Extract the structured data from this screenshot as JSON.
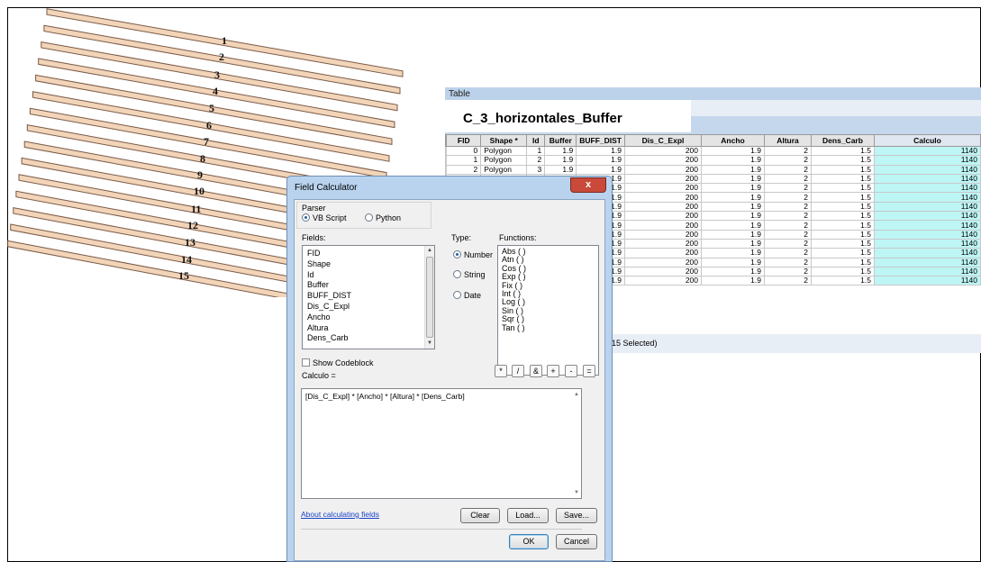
{
  "map": {
    "strip_labels": [
      "1",
      "2",
      "3",
      "4",
      "5",
      "6",
      "7",
      "8",
      "9",
      "10",
      "11",
      "12",
      "13",
      "14",
      "15"
    ]
  },
  "table_window": {
    "title": "Table",
    "layer_name": "C_3_horizontales_Buffer",
    "columns": [
      "FID",
      "Shape *",
      "Id",
      "Buffer",
      "BUFF_DIST",
      "Dis_C_Expl",
      "Ancho",
      "Altura",
      "Dens_Carb",
      "Calculo"
    ],
    "rows": [
      [
        "0",
        "Polygon",
        "1",
        "1.9",
        "1.9",
        "200",
        "1.9",
        "2",
        "1.5",
        "1140"
      ],
      [
        "1",
        "Polygon",
        "2",
        "1.9",
        "1.9",
        "200",
        "1.9",
        "2",
        "1.5",
        "1140"
      ],
      [
        "2",
        "Polygon",
        "3",
        "1.9",
        "1.9",
        "200",
        "1.9",
        "2",
        "1.5",
        "1140"
      ],
      [
        "",
        "",
        "",
        "",
        "1.9",
        "200",
        "1.9",
        "2",
        "1.5",
        "1140"
      ],
      [
        "",
        "",
        "",
        "",
        "1.9",
        "200",
        "1.9",
        "2",
        "1.5",
        "1140"
      ],
      [
        "",
        "",
        "",
        "",
        "1.9",
        "200",
        "1.9",
        "2",
        "1.5",
        "1140"
      ],
      [
        "",
        "",
        "",
        "",
        "1.9",
        "200",
        "1.9",
        "2",
        "1.5",
        "1140"
      ],
      [
        "",
        "",
        "",
        "",
        "1.9",
        "200",
        "1.9",
        "2",
        "1.5",
        "1140"
      ],
      [
        "",
        "",
        "",
        "",
        "1.9",
        "200",
        "1.9",
        "2",
        "1.5",
        "1140"
      ],
      [
        "",
        "",
        "",
        "",
        "1.9",
        "200",
        "1.9",
        "2",
        "1.5",
        "1140"
      ],
      [
        "",
        "",
        "",
        "",
        "1.9",
        "200",
        "1.9",
        "2",
        "1.5",
        "1140"
      ],
      [
        "",
        "",
        "",
        "",
        "1.9",
        "200",
        "1.9",
        "2",
        "1.5",
        "1140"
      ],
      [
        "",
        "",
        "",
        "",
        "1.9",
        "200",
        "1.9",
        "2",
        "1.5",
        "1140"
      ],
      [
        "",
        "",
        "",
        "",
        "1.9",
        "200",
        "1.9",
        "2",
        "1.5",
        "1140"
      ],
      [
        "",
        "",
        "",
        "",
        "1.9",
        "200",
        "1.9",
        "2",
        "1.5",
        "1140"
      ]
    ],
    "selection_status": "t of 15 Selected)"
  },
  "field_calculator": {
    "title": "Field Calculator",
    "close_glyph": "x",
    "parser_label": "Parser",
    "parser_vb": "VB Script",
    "parser_python": "Python",
    "fields_label": "Fields:",
    "fields": [
      "FID",
      "Shape",
      "Id",
      "Buffer",
      "BUFF_DIST",
      "Dis_C_Expl",
      "Ancho",
      "Altura",
      "Dens_Carb"
    ],
    "type_label": "Type:",
    "type_number": "Number",
    "type_string": "String",
    "type_date": "Date",
    "functions_label": "Functions:",
    "functions": [
      "Abs ( )",
      "Atn ( )",
      "Cos ( )",
      "Exp ( )",
      "Fix ( )",
      "Int ( )",
      "Log ( )",
      "Sin ( )",
      "Sqr ( )",
      "Tan ( )"
    ],
    "show_codeblock": "Show Codeblock",
    "target_label": "Calculo =",
    "operators": [
      "*",
      "/",
      "&",
      "+",
      "-",
      "="
    ],
    "expression": "[Dis_C_Expl] * [Ancho] * [Altura] * [Dens_Carb]",
    "about_link": "About calculating fields",
    "clear_label": "Clear",
    "load_label": "Load...",
    "save_label": "Save...",
    "ok_label": "OK",
    "cancel_label": "Cancel"
  },
  "colors": {
    "strip_fill": "#f2d4b9",
    "selected_cell": "#bef5f5",
    "dialog_frame": "#b9d3ee"
  }
}
